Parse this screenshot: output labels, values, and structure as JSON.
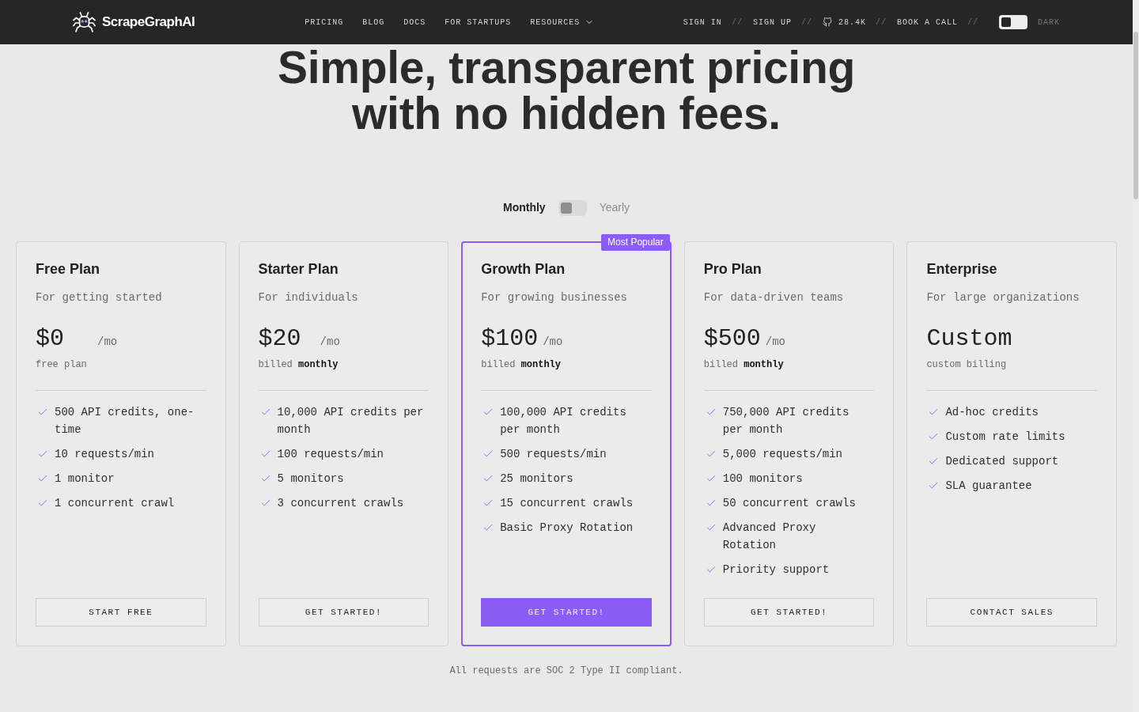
{
  "navbar": {
    "logo": {
      "text": "ScrapeGraphAI"
    },
    "links": [
      {
        "label": "PRICING",
        "kind": "link"
      },
      {
        "label": "BLOG",
        "kind": "link"
      },
      {
        "label": "DOCS",
        "kind": "link"
      },
      {
        "label": "FOR STARTUPS",
        "kind": "link"
      },
      {
        "label": "RESOURCES",
        "kind": "dropdown"
      }
    ],
    "actions": [
      {
        "label": "SIGN IN",
        "kind": "link",
        "separator": "//"
      },
      {
        "label": "SIGN UP",
        "kind": "link",
        "separator": "//"
      },
      {
        "label": "28.4K",
        "kind": "github",
        "separator": "//"
      },
      {
        "label": "BOOK A CALL",
        "kind": "link",
        "separator": "//"
      }
    ],
    "theme_toggle": {
      "label": "DARK",
      "on": false
    }
  },
  "hero": {
    "title": "Simple, transparent pricing with no hidden fees."
  },
  "billing": [
    {
      "label": "Monthly",
      "selected": true
    },
    {
      "label": "Yearly",
      "selected": false
    }
  ],
  "plans": [
    {
      "name": "Free Plan",
      "tagline": "For getting started",
      "price": "$0",
      "period": "/mo",
      "note": "free plan",
      "featured": false,
      "features": [
        "500 API credits, one-time",
        "10 requests/min",
        "1 monitor",
        "1 concurrent crawl"
      ],
      "button": "START FREE"
    },
    {
      "name": "Starter Plan",
      "tagline": "For individuals",
      "price": "$20",
      "period": "/mo",
      "note": "billed **monthly**",
      "featured": false,
      "features": [
        "10,000 API credits per month",
        "100 requests/min",
        "5 monitors",
        "3 concurrent crawls"
      ],
      "button": "GET STARTED!"
    },
    {
      "name": "Growth Plan",
      "tagline": "For growing businesses",
      "price": "$100",
      "period": "/mo",
      "note": "billed **monthly**",
      "featured": true,
      "badge": "Most Popular",
      "features": [
        "100,000 API credits per month",
        "500 requests/min",
        "25 monitors",
        "15 concurrent crawls",
        "Basic Proxy Rotation"
      ],
      "button": "GET STARTED!"
    },
    {
      "name": "Pro Plan",
      "tagline": "For data-driven teams",
      "price": "$500",
      "period": "/mo",
      "note": "billed **monthly**",
      "featured": false,
      "features": [
        "750,000 API credits per month",
        "5,000 requests/min",
        "100 monitors",
        "50 concurrent crawls",
        "Advanced Proxy Rotation",
        "Priority support"
      ],
      "button": "GET STARTED!"
    },
    {
      "name": "Enterprise",
      "tagline": "For large organizations",
      "price": "Custom",
      "note": "custom billing",
      "featured": false,
      "features": [
        "Ad-hoc credits",
        "Custom rate limits",
        "Dedicated support",
        "SLA guarantee"
      ],
      "button": "CONTACT SALES"
    }
  ],
  "footnote": "All requests are SOC 2 Type II compliant."
}
